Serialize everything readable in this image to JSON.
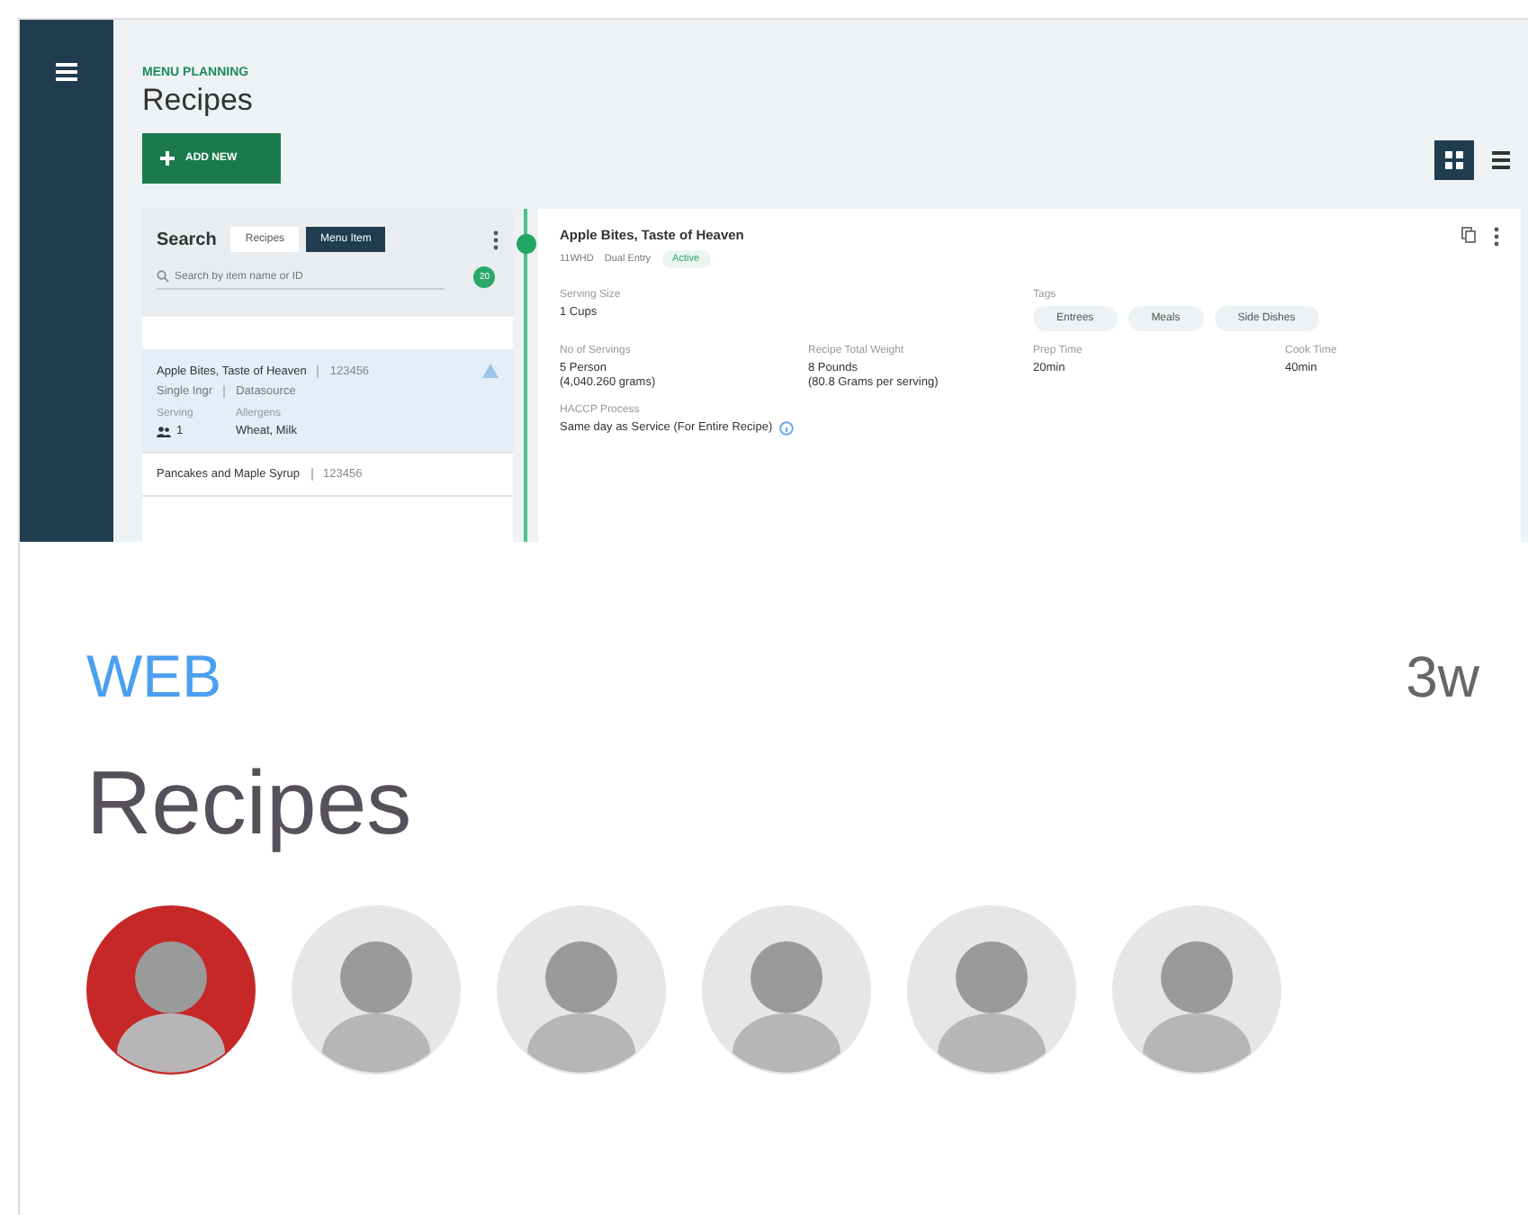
{
  "preview": {
    "section_label": "MENU PLANNING",
    "title": "Recipes",
    "add_button": "ADD NEW",
    "views": [
      {
        "kind": "grid",
        "selected": true
      },
      {
        "kind": "list",
        "selected": false
      }
    ],
    "search": {
      "label": "Search",
      "tabs": [
        {
          "label": "Recipes",
          "selected": false
        },
        {
          "label": "Menu Item",
          "selected": true
        }
      ],
      "placeholder": "Search by item name or ID",
      "badge": "20"
    },
    "items": [
      {
        "name": "Apple Bites, Taste of Heaven",
        "code": "123456",
        "type": "Single Ingr",
        "source": "Datasource",
        "serving_label": "Serving",
        "serving": "1",
        "allergens_label": "Allergens",
        "allergens": "Wheat, Milk",
        "selected": true,
        "warning": true
      },
      {
        "name": "Pancakes and Maple Syrup",
        "code": "123456",
        "selected": false,
        "warning": false
      }
    ],
    "detail": {
      "title": "Apple Bites, Taste of Heaven",
      "code": "11WHD",
      "entry": "Dual Entry",
      "status": "Active",
      "fields": [
        {
          "label": "Serving Size",
          "lines": [
            "1 Cups"
          ]
        },
        {
          "label": "Tags",
          "tags": [
            "Entrees",
            "Meals",
            "Side Dishes"
          ]
        },
        {
          "label": "No of Servings",
          "lines": [
            "5 Person",
            "(4,040.260 grams)"
          ]
        },
        {
          "label": "Recipe Total Weight",
          "lines": [
            "8 Pounds",
            "(80.8 Grams per serving)"
          ]
        },
        {
          "label": "Prep Time",
          "lines": [
            "20min"
          ]
        },
        {
          "label": "Cook Time",
          "lines": [
            "40min"
          ]
        },
        {
          "label": "HACCP Process",
          "lines": [
            "Same day as Service (For Entire Recipe)"
          ],
          "info": true
        }
      ]
    }
  },
  "category": "WEB",
  "age": "3w",
  "title": "Recipes",
  "avatars": [
    {
      "color": "#c62828"
    },
    {
      "color": "#e6e6e6"
    },
    {
      "color": "#e6e6e6"
    },
    {
      "color": "#e6e6e6"
    },
    {
      "color": "#e6e6e6"
    },
    {
      "color": "#e6e6e6"
    }
  ]
}
